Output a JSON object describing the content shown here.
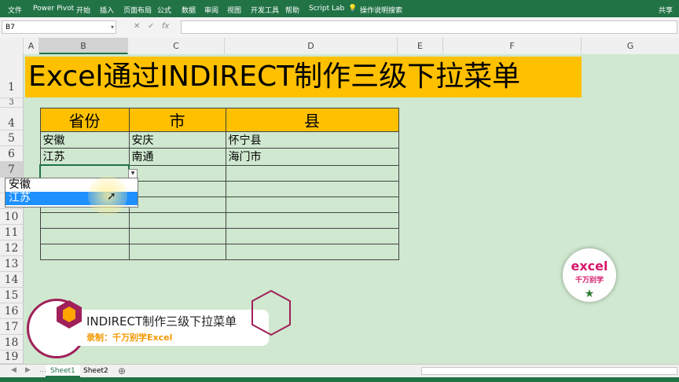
{
  "ribbon": {
    "tabs": [
      "文件",
      "Power Pivot",
      "开始",
      "插入",
      "页面布局",
      "公式",
      "数据",
      "审阅",
      "视图",
      "开发工具",
      "帮助",
      "Script Lab"
    ],
    "search": "操作说明搜索",
    "share": "共享"
  },
  "formula_bar": {
    "name_box": "B7",
    "value": ""
  },
  "columns": [
    "A",
    "B",
    "C",
    "D",
    "E",
    "F",
    "G"
  ],
  "rows": [
    "1",
    "3",
    "4",
    "5",
    "6",
    "7",
    "8",
    "9",
    "10",
    "11",
    "12",
    "13",
    "14",
    "15",
    "16",
    "17",
    "18",
    "19"
  ],
  "title": "Excel通过INDIRECT制作三级下拉菜单",
  "table": {
    "headers": [
      "省份",
      "市",
      "县"
    ],
    "rows": [
      [
        "安徽",
        "安庆",
        "怀宁县"
      ],
      [
        "江苏",
        "南通",
        "海门市"
      ]
    ]
  },
  "dropdown": {
    "options": [
      "安徽",
      "江苏"
    ],
    "selected": "江苏"
  },
  "logo": {
    "line1": "excel",
    "line2": "千万别学"
  },
  "banner": {
    "title": "INDIRECT制作三级下拉菜单",
    "subtitle": "录制：千万别学Excel"
  },
  "sheets": [
    "Sheet1",
    "Sheet2"
  ],
  "colors": {
    "ribbon": "#217346",
    "title_bg": "#ffc000",
    "sheet_bg": "#cfe8cf",
    "dropdown_selected": "#1e90ff",
    "logo_text": "#d6186b",
    "banner_subtitle": "#f39800"
  }
}
